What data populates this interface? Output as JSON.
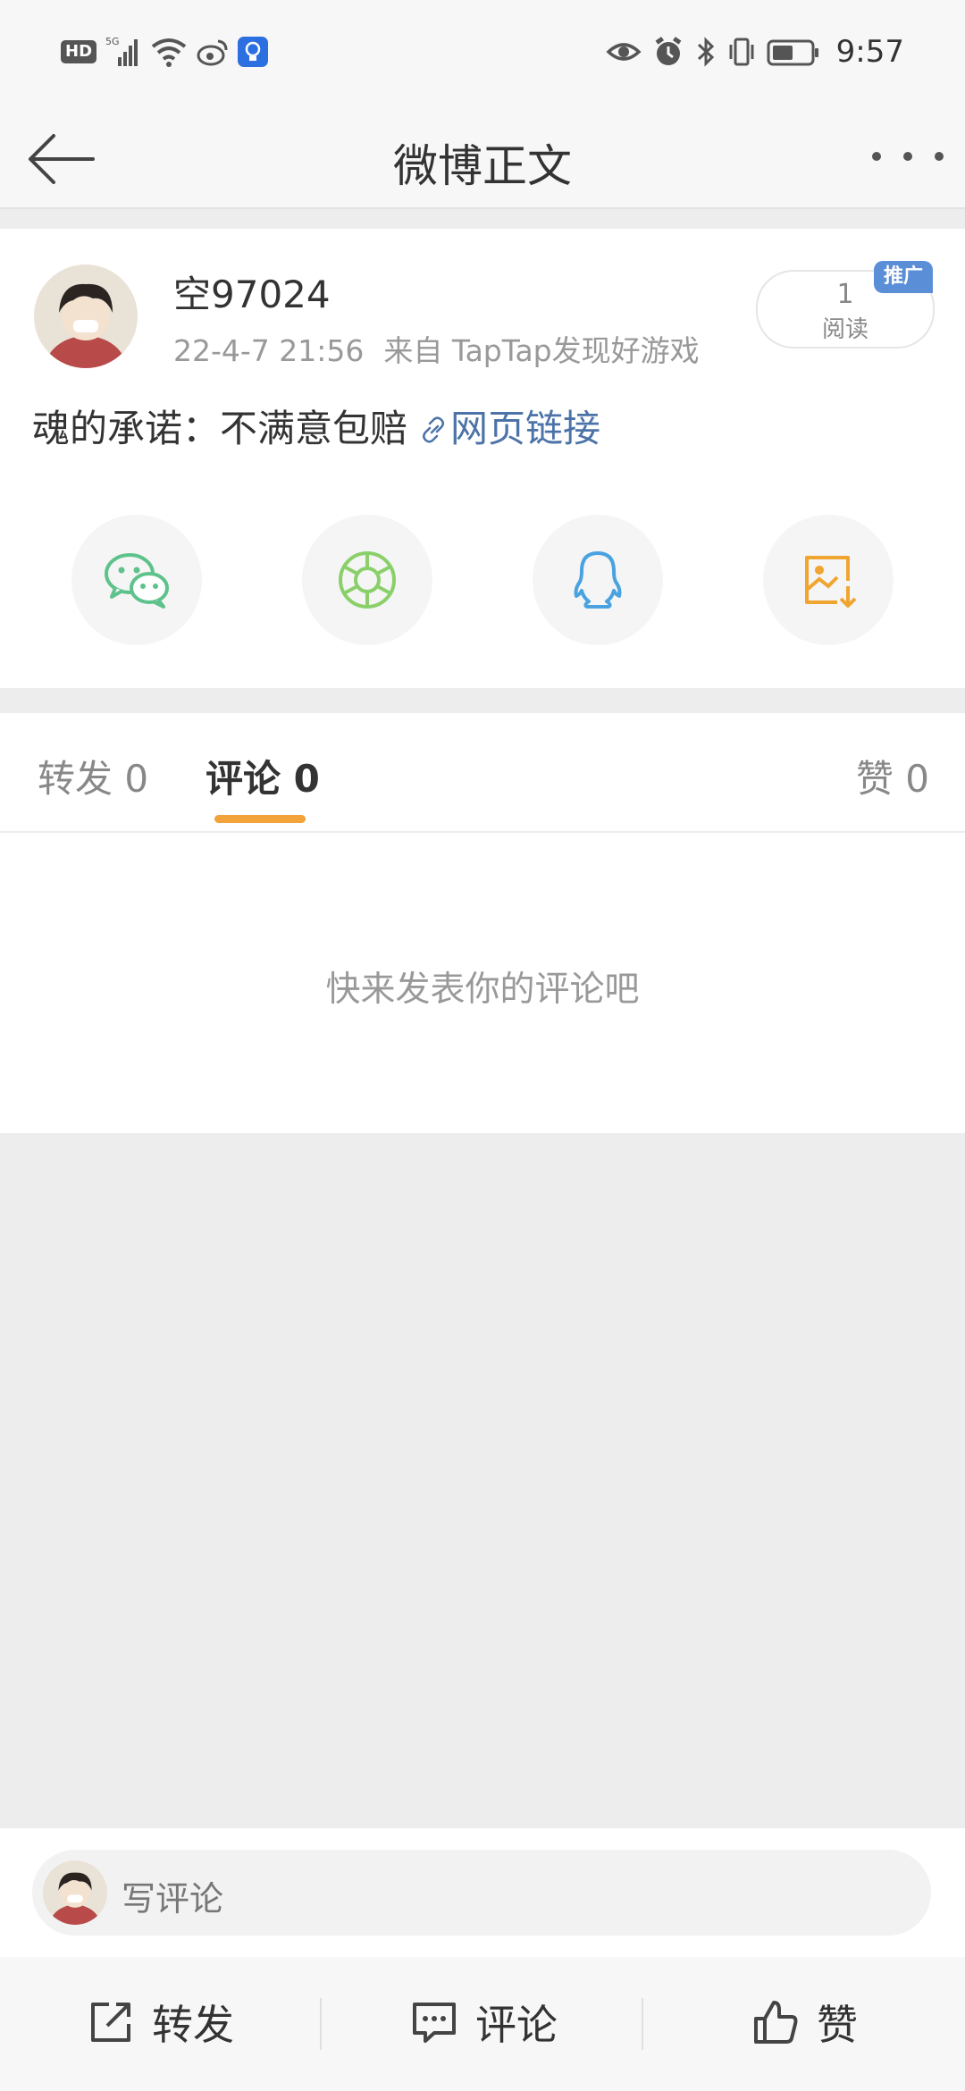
{
  "status_bar": {
    "hd": "HD",
    "network": "5G",
    "time": "9:57"
  },
  "header": {
    "title": "微博正文"
  },
  "post": {
    "username": "空97024",
    "timestamp": "22-4-7 21:56",
    "source": "来自 TapTap发现好游戏",
    "read_count": "1",
    "read_label": "阅读",
    "promo_tag": "推广",
    "text": "魂的承诺：不满意包赔",
    "link_text": "网页链接"
  },
  "share": {
    "items": [
      "wechat-icon",
      "moments-icon",
      "qq-icon",
      "save-image-icon"
    ],
    "colors": {
      "wechat": "#5ec28b",
      "moments": "#8ad06a",
      "qq": "#4aa3e0",
      "save": "#f0a531"
    }
  },
  "tabs": {
    "repost_label": "转发",
    "repost_count": "0",
    "comment_label": "评论",
    "comment_count": "0",
    "like_label": "赞",
    "like_count": "0",
    "accent": "#f2a33a"
  },
  "comments": {
    "empty_text": "快来发表你的评论吧"
  },
  "comment_input": {
    "placeholder": "写评论"
  },
  "actions": {
    "repost": "转发",
    "comment": "评论",
    "like": "赞"
  }
}
